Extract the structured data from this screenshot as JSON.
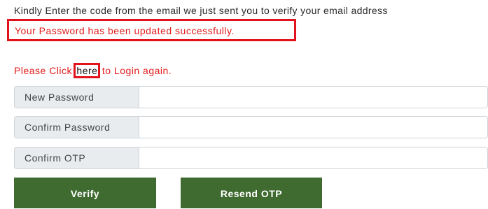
{
  "instruction_text": "Kindly Enter the code from the email we just sent you to verify your email address",
  "success_message": "Your Password has been updated successfully.",
  "login_prompt": {
    "before": "Please Click ",
    "link": "here",
    "after": " to Login again."
  },
  "fields": {
    "new_password": {
      "label": "New Password",
      "value": ""
    },
    "confirm_password": {
      "label": "Confirm Password",
      "value": ""
    },
    "confirm_otp": {
      "label": "Confirm OTP",
      "value": ""
    }
  },
  "buttons": {
    "verify": "Verify",
    "resend": "Resend OTP"
  },
  "colors": {
    "error_text": "#e21b1b",
    "highlight_border": "#e2131c",
    "button_bg": "#3f6b31",
    "label_bg": "#e9ecef"
  }
}
